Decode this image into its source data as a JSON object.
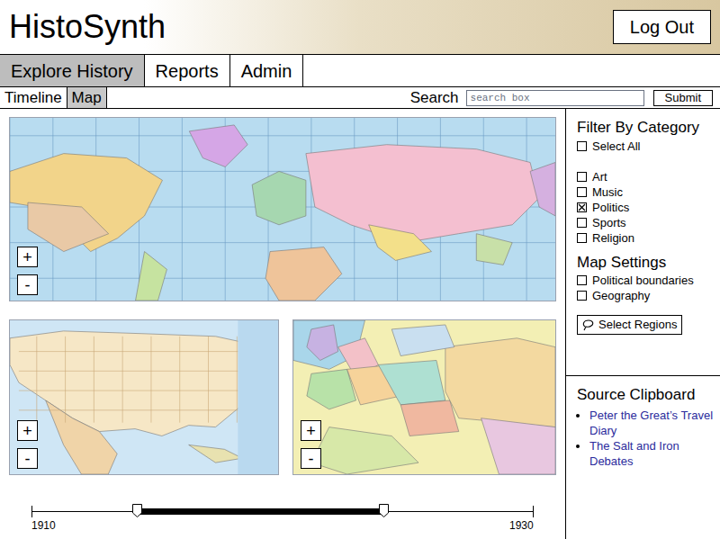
{
  "app": {
    "title": "HistoSynth",
    "logout": "Log Out"
  },
  "nav_tabs": [
    {
      "label": "Explore History",
      "selected": true
    },
    {
      "label": "Reports",
      "selected": false
    },
    {
      "label": "Admin",
      "selected": false
    }
  ],
  "view_tabs": [
    {
      "label": "Timeline",
      "selected": false
    },
    {
      "label": "Map",
      "selected": true
    }
  ],
  "search": {
    "label": "Search",
    "placeholder": "search box",
    "button": "Submit"
  },
  "maps": [
    {
      "kind": "world",
      "zoom_in": "+",
      "zoom_out": "-"
    },
    {
      "kind": "usa",
      "zoom_in": "+",
      "zoom_out": "-"
    },
    {
      "kind": "europe",
      "zoom_in": "+",
      "zoom_out": "-"
    }
  ],
  "filter": {
    "title": "Filter By Category",
    "select_all": {
      "label": "Select All",
      "checked": false
    },
    "categories": [
      {
        "label": "Art",
        "checked": false
      },
      {
        "label": "Music",
        "checked": false
      },
      {
        "label": "Politics",
        "checked": true
      },
      {
        "label": "Sports",
        "checked": false
      },
      {
        "label": "Religion",
        "checked": false
      }
    ]
  },
  "map_settings": {
    "title": "Map Settings",
    "options": [
      {
        "label": "Political boundaries",
        "checked": false
      },
      {
        "label": "Geography",
        "checked": false
      }
    ]
  },
  "select_regions": "Select Regions",
  "clipboard": {
    "title": "Source Clipboard",
    "items": [
      "Peter the Great’s Travel Diary",
      "The Salt and Iron Debates"
    ]
  },
  "timeline": {
    "start_label": "1910",
    "end_label": "1930",
    "level_start": 0.21,
    "level_end": 0.7
  }
}
